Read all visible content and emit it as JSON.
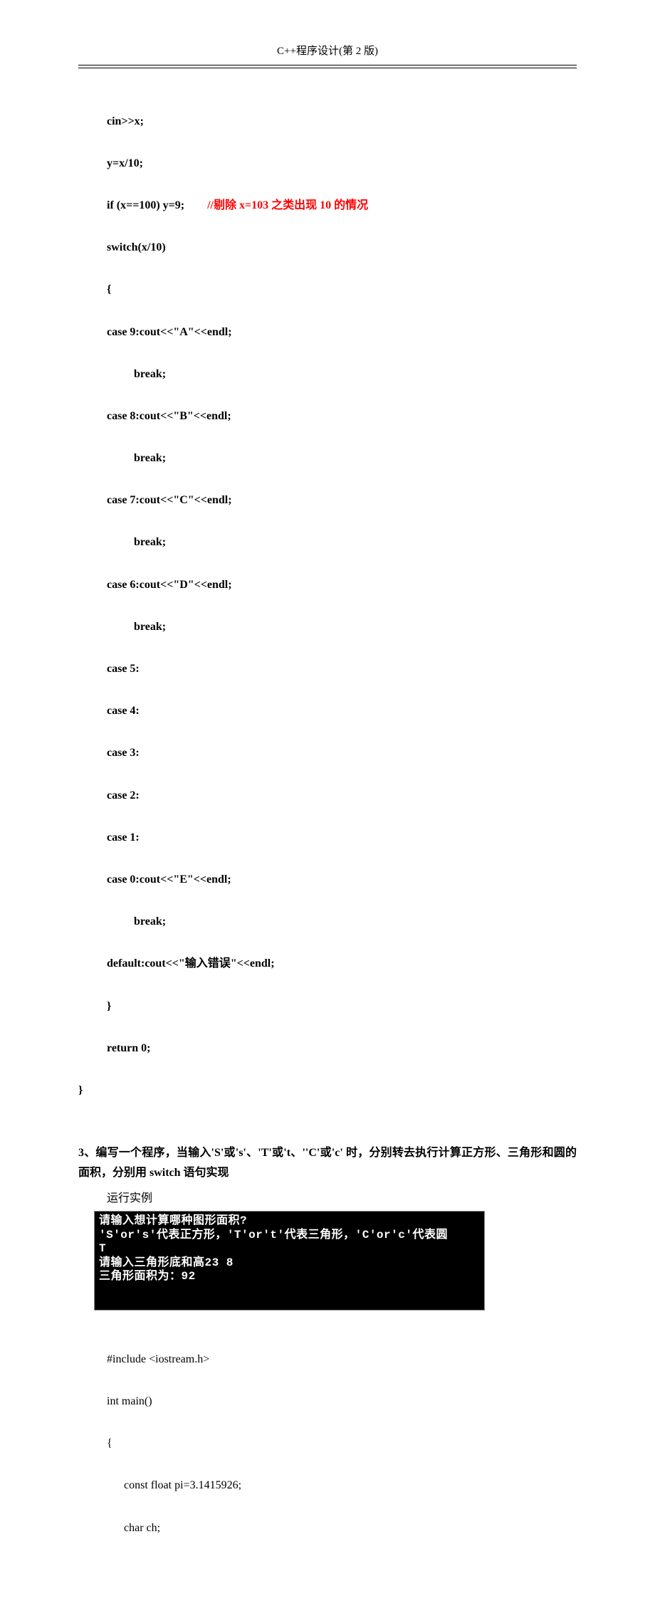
{
  "header": "C++程序设计(第 2 版)",
  "code1": {
    "l1": "cin>>x;",
    "l2": "y=x/10;",
    "l3a": "if (x==100) y=9;        ",
    "l3b": "//剔除 x=103 之类出现 10 的情况",
    "l4": "switch(x/10)",
    "l5": "{",
    "l6": "case 9:cout<<\"A\"<<endl;",
    "l7": "break;",
    "l8": "case 8:cout<<\"B\"<<endl;",
    "l9": "break;",
    "l10": "case 7:cout<<\"C\"<<endl;",
    "l11": "break;",
    "l12": "case 6:cout<<\"D\"<<endl;",
    "l13": "break;",
    "l14": "case 5:",
    "l15": "case 4:",
    "l16": "case 3:",
    "l17": "case 2:",
    "l18": "case 1:",
    "l19": "case 0:cout<<\"E\"<<endl;",
    "l20": "break;",
    "l21": "default:cout<<\"输入错误\"<<endl;",
    "l22": "}",
    "l23": "return 0;",
    "l24": "}"
  },
  "question": {
    "prefix": "3、编写一个程序，当输入'S'或's'、'T'或't、''C'或'c'  时，分别转去执行计算正方形、三角形和圆的面积，分别用 switch 语句实现"
  },
  "run_label": "运行实例",
  "console": {
    "l1": "请输入想计算哪种图形面积?",
    "l2": "'S'or's'代表正方形，'T'or't'代表三角形，'C'or'c'代表圆",
    "l3": "T",
    "l4": "请输入三角形底和高23 8",
    "l5": "三角形面积为：92"
  },
  "code2": {
    "l1": "#include <iostream.h>",
    "l2": "int main()",
    "l3": "{",
    "l4": "      const float pi=3.1415926;",
    "l5": "      char ch;"
  }
}
